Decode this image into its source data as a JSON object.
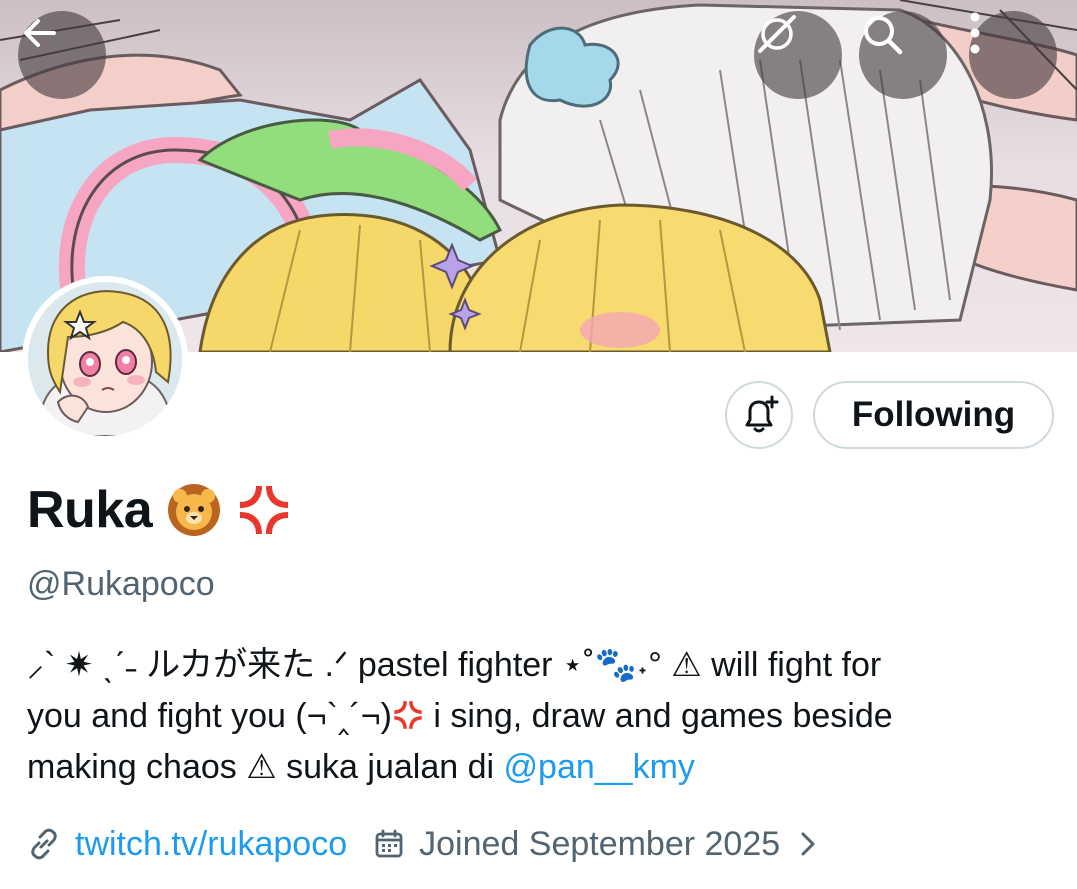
{
  "profile": {
    "display_name": "Ruka",
    "name_emojis": [
      "lion-face",
      "anger-symbol"
    ],
    "handle": "@Rukapoco",
    "bio": {
      "line1": "⸝` ✷ ˎˊ˗ ルカが来た .ᐟ pastel fighter ⋆˚🐾˖° ⚠ will fight for",
      "line2_a": "you and fight you (¬`‸´¬)",
      "line2_b": " i sing, draw and games beside",
      "line3_a": "making chaos ⚠ suka jualan di ",
      "mention": "@pan__kmy"
    },
    "website": "twitch.tv/rukapoco",
    "joined": "Joined September 2025"
  },
  "actions": {
    "following_label": "Following"
  },
  "colors": {
    "link": "#1d9bf0",
    "secondary_text": "#536471",
    "border": "#cfd9de",
    "anger": "#e8372c"
  },
  "icons": {
    "back": "arrow-left-icon",
    "grok": "grok-icon",
    "search": "search-icon",
    "more": "more-vertical-icon",
    "notify": "bell-plus-icon",
    "link": "link-icon",
    "calendar": "calendar-icon",
    "chevron": "chevron-right-icon"
  }
}
